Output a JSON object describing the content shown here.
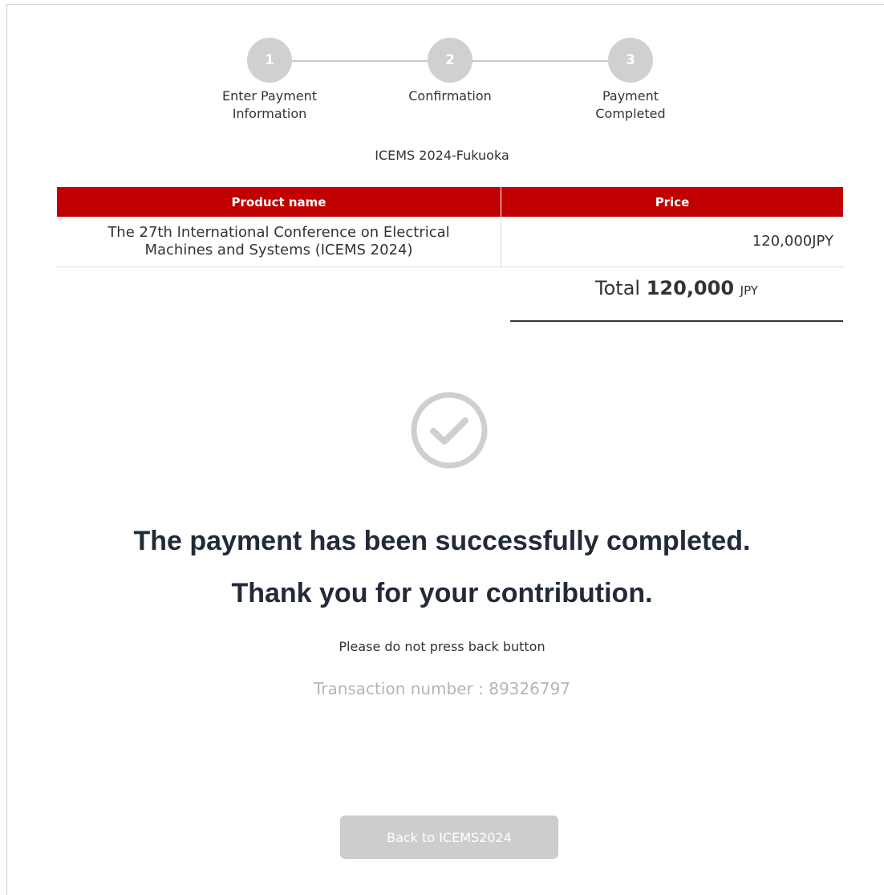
{
  "stepper": {
    "steps": [
      {
        "number": "1",
        "label": "Enter Payment Information"
      },
      {
        "number": "2",
        "label": "Confirmation"
      },
      {
        "number": "3",
        "label": "Payment Completed"
      }
    ]
  },
  "event_name": "ICEMS 2024-Fukuoka",
  "table": {
    "headers": {
      "product": "Product name",
      "price": "Price"
    },
    "rows": [
      {
        "product": "The 27th International Conference on Electrical Machines and Systems (ICEMS 2024)",
        "price": "120,000JPY"
      }
    ]
  },
  "total": {
    "label": "Total",
    "amount": "120,000",
    "currency": "JPY"
  },
  "status_icon": "check-circle-icon",
  "messages": {
    "success": "The payment has been successfully completed.",
    "thanks": "Thank you for your contribution.",
    "note": "Please do not press back button",
    "transaction": "Transaction number : 89326797"
  },
  "back_button": {
    "label": "Back to ICEMS2024"
  },
  "colors": {
    "header_red": "#c00000",
    "step_gray": "#d0d0d0",
    "heading_navy": "#222a3a",
    "button_gray": "#cdcdcd"
  }
}
